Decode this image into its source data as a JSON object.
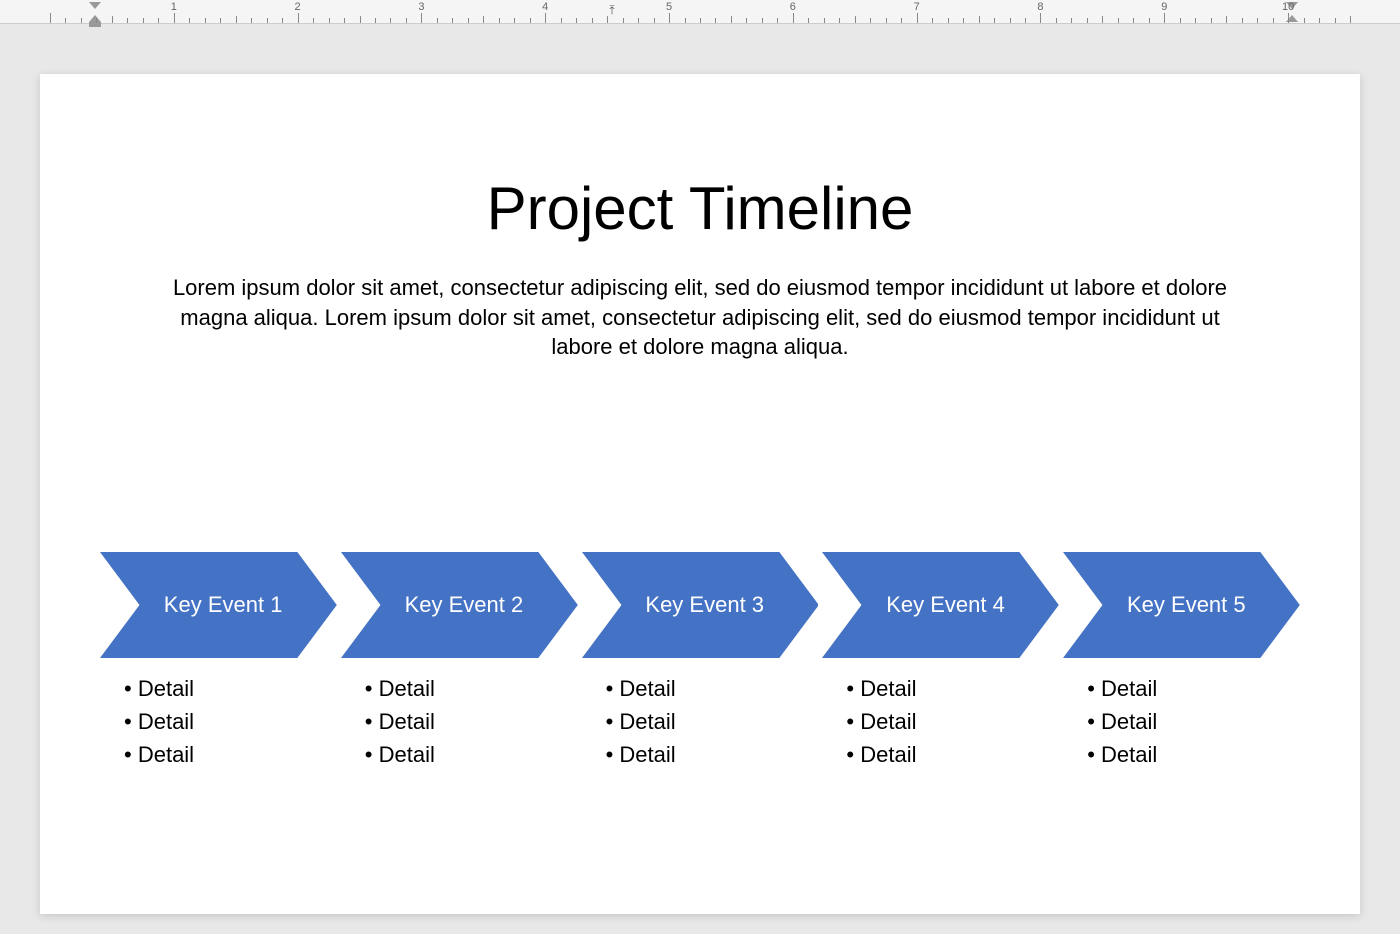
{
  "ruler": {
    "numbers": [
      "1",
      "2",
      "3",
      "4",
      "5",
      "6",
      "7",
      "8",
      "9",
      "10"
    ]
  },
  "slide": {
    "title": "Project Timeline",
    "description": "Lorem ipsum dolor sit amet, consectetur adipiscing elit, sed do eiusmod tempor incididunt ut labore et dolore magna aliqua. Lorem ipsum dolor sit amet, consectetur adipiscing elit, sed do eiusmod tempor incididunt ut labore et dolore magna aliqua."
  },
  "timeline": {
    "arrow_color": "#4472c4",
    "events": [
      {
        "label": "Key Event 1",
        "details": [
          "Detail",
          "Detail",
          "Detail"
        ]
      },
      {
        "label": "Key Event 2",
        "details": [
          "Detail",
          "Detail",
          "Detail"
        ]
      },
      {
        "label": "Key Event 3",
        "details": [
          "Detail",
          "Detail",
          "Detail"
        ]
      },
      {
        "label": "Key Event 4",
        "details": [
          "Detail",
          "Detail",
          "Detail"
        ]
      },
      {
        "label": "Key Event 5",
        "details": [
          "Detail",
          "Detail",
          "Detail"
        ]
      }
    ]
  }
}
